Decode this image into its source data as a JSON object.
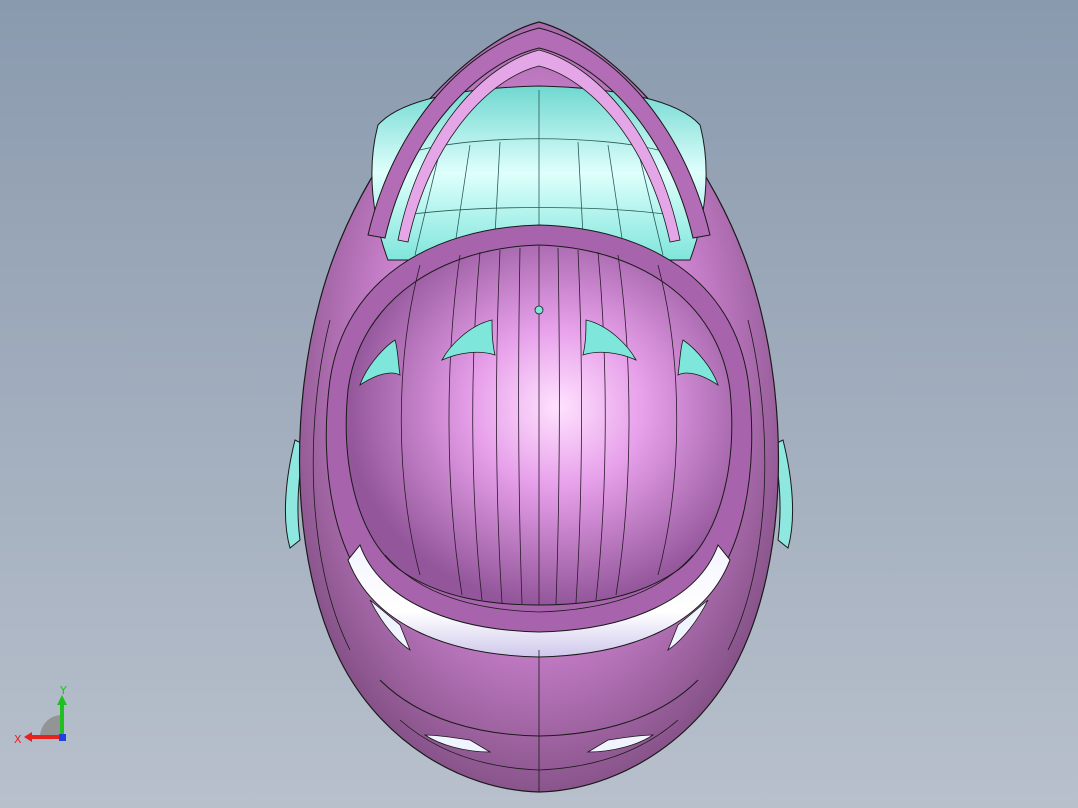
{
  "viewport": {
    "background_top": "#8a9aae",
    "background_bottom": "#b8c0cc"
  },
  "model": {
    "name": "helmet",
    "view": "top",
    "shell_color": "#c77ecb",
    "shell_highlight": "#f2b7f5",
    "shell_shadow": "#7d4a7e",
    "visor_color": "#8ff0e6",
    "visor_highlight": "#e8fffd",
    "edge_color": "#1a1a1a"
  },
  "triad": {
    "x_label": "X",
    "y_label": "Y",
    "x_color": "#e8201e",
    "y_color": "#20c020",
    "z_color": "#2040e0"
  }
}
